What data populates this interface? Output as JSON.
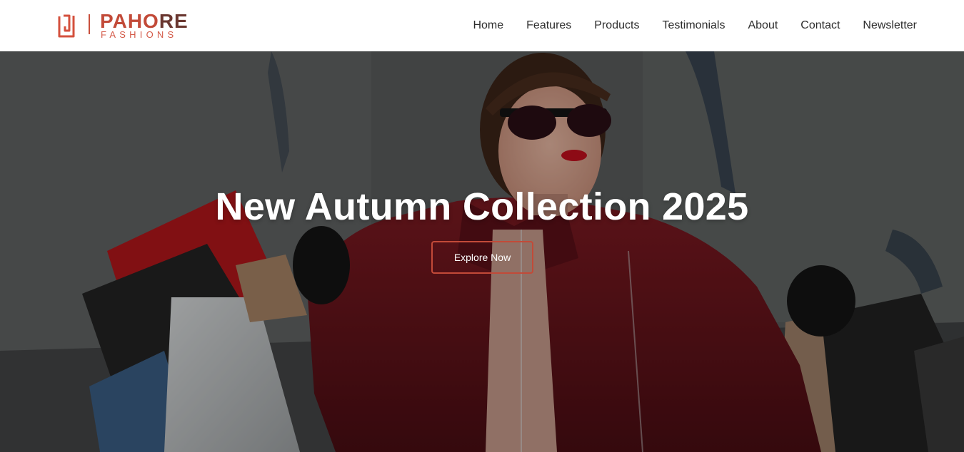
{
  "brand": {
    "name_part1": "PAHO",
    "name_part2": "RE",
    "tagline": "FASHIONS",
    "colors": {
      "primary": "#c24a38",
      "dark": "#6a3730"
    }
  },
  "nav": {
    "items": [
      {
        "label": "Home"
      },
      {
        "label": "Features"
      },
      {
        "label": "Products"
      },
      {
        "label": "Testimonials"
      },
      {
        "label": "About"
      },
      {
        "label": "Contact"
      },
      {
        "label": "Newsletter"
      }
    ]
  },
  "hero": {
    "title": "New Autumn Collection 2025",
    "cta_label": "Explore Now",
    "accent_color": "#c24a38"
  }
}
